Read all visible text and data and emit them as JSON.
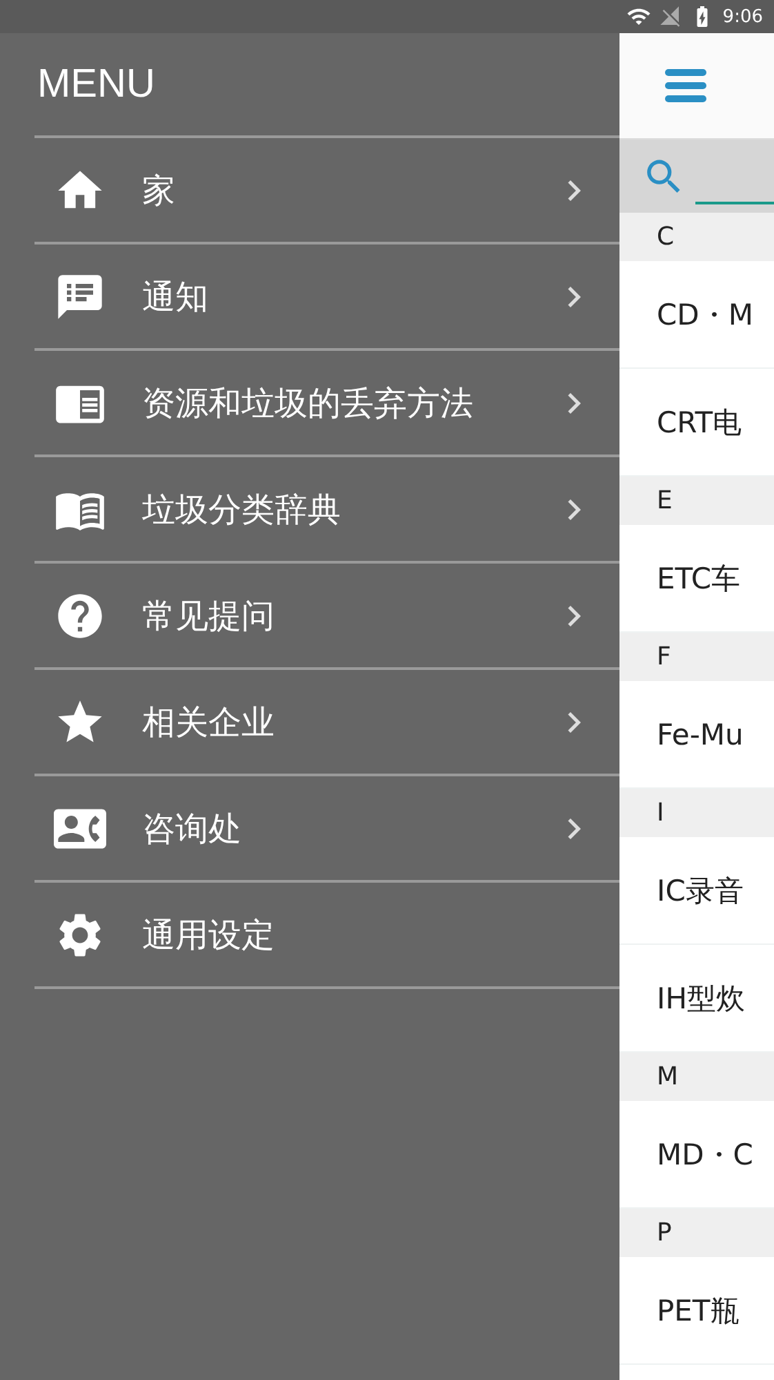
{
  "status_bar": {
    "time": "9:06"
  },
  "menu": {
    "title": "MENU",
    "items": [
      {
        "label": "家",
        "chevron": true
      },
      {
        "label": "通知",
        "chevron": true
      },
      {
        "label": "资源和垃圾的丢弃方法",
        "chevron": true
      },
      {
        "label": "垃圾分类辞典",
        "chevron": true
      },
      {
        "label": "常见提问",
        "chevron": true
      },
      {
        "label": "相关企业",
        "chevron": true
      },
      {
        "label": "咨询处",
        "chevron": true
      },
      {
        "label": "通用设定",
        "chevron": false
      }
    ]
  },
  "list": [
    {
      "kind": "section",
      "label": "C"
    },
    {
      "kind": "item",
      "label": "CD・M"
    },
    {
      "kind": "item",
      "label": "CRT电"
    },
    {
      "kind": "section",
      "label": "E"
    },
    {
      "kind": "item",
      "label": "ETC车"
    },
    {
      "kind": "section",
      "label": "F"
    },
    {
      "kind": "item",
      "label": "Fe-Mu"
    },
    {
      "kind": "section",
      "label": "I"
    },
    {
      "kind": "item",
      "label": "IC录音"
    },
    {
      "kind": "item",
      "label": "IH型炊"
    },
    {
      "kind": "section",
      "label": "M"
    },
    {
      "kind": "item",
      "label": "MD・C"
    },
    {
      "kind": "section",
      "label": "P"
    },
    {
      "kind": "item",
      "label": "PET瓶"
    }
  ]
}
